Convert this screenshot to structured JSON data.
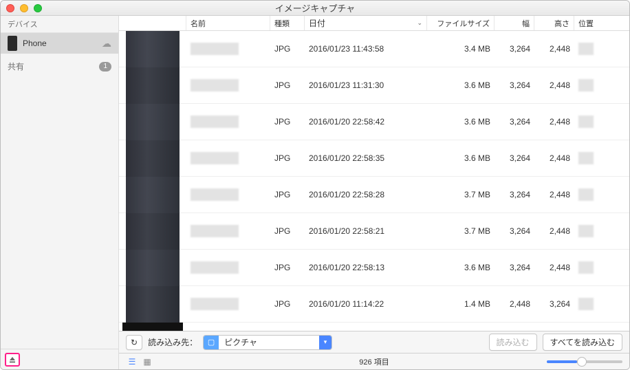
{
  "window": {
    "title": "イメージキャプチャ"
  },
  "sidebar": {
    "devices_label": "デバイス",
    "device_name": "Phone",
    "shared_label": "共有",
    "shared_badge": "1"
  },
  "columns": {
    "name": "名前",
    "kind": "種類",
    "date": "日付",
    "size": "ファイルサイズ",
    "width": "幅",
    "height": "高さ",
    "position": "位置"
  },
  "rows": [
    {
      "kind": "JPG",
      "date": "2016/01/23 11:43:58",
      "size": "3.4 MB",
      "w": "3,264",
      "h": "2,448"
    },
    {
      "kind": "JPG",
      "date": "2016/01/23 11:31:30",
      "size": "3.6 MB",
      "w": "3,264",
      "h": "2,448"
    },
    {
      "kind": "JPG",
      "date": "2016/01/20 22:58:42",
      "size": "3.6 MB",
      "w": "3,264",
      "h": "2,448"
    },
    {
      "kind": "JPG",
      "date": "2016/01/20 22:58:35",
      "size": "3.6 MB",
      "w": "3,264",
      "h": "2,448"
    },
    {
      "kind": "JPG",
      "date": "2016/01/20 22:58:28",
      "size": "3.7 MB",
      "w": "3,264",
      "h": "2,448"
    },
    {
      "kind": "JPG",
      "date": "2016/01/20 22:58:21",
      "size": "3.7 MB",
      "w": "3,264",
      "h": "2,448"
    },
    {
      "kind": "JPG",
      "date": "2016/01/20 22:58:13",
      "size": "3.6 MB",
      "w": "3,264",
      "h": "2,448"
    },
    {
      "kind": "JPG",
      "date": "2016/01/20 11:14:22",
      "size": "1.4 MB",
      "w": "2,448",
      "h": "3,264"
    }
  ],
  "toolbar": {
    "import_to_label": "読み込み先：",
    "destination": "ピクチャ",
    "import": "読み込む",
    "import_all": "すべてを読み込む"
  },
  "status": {
    "item_count": "926 項目"
  }
}
